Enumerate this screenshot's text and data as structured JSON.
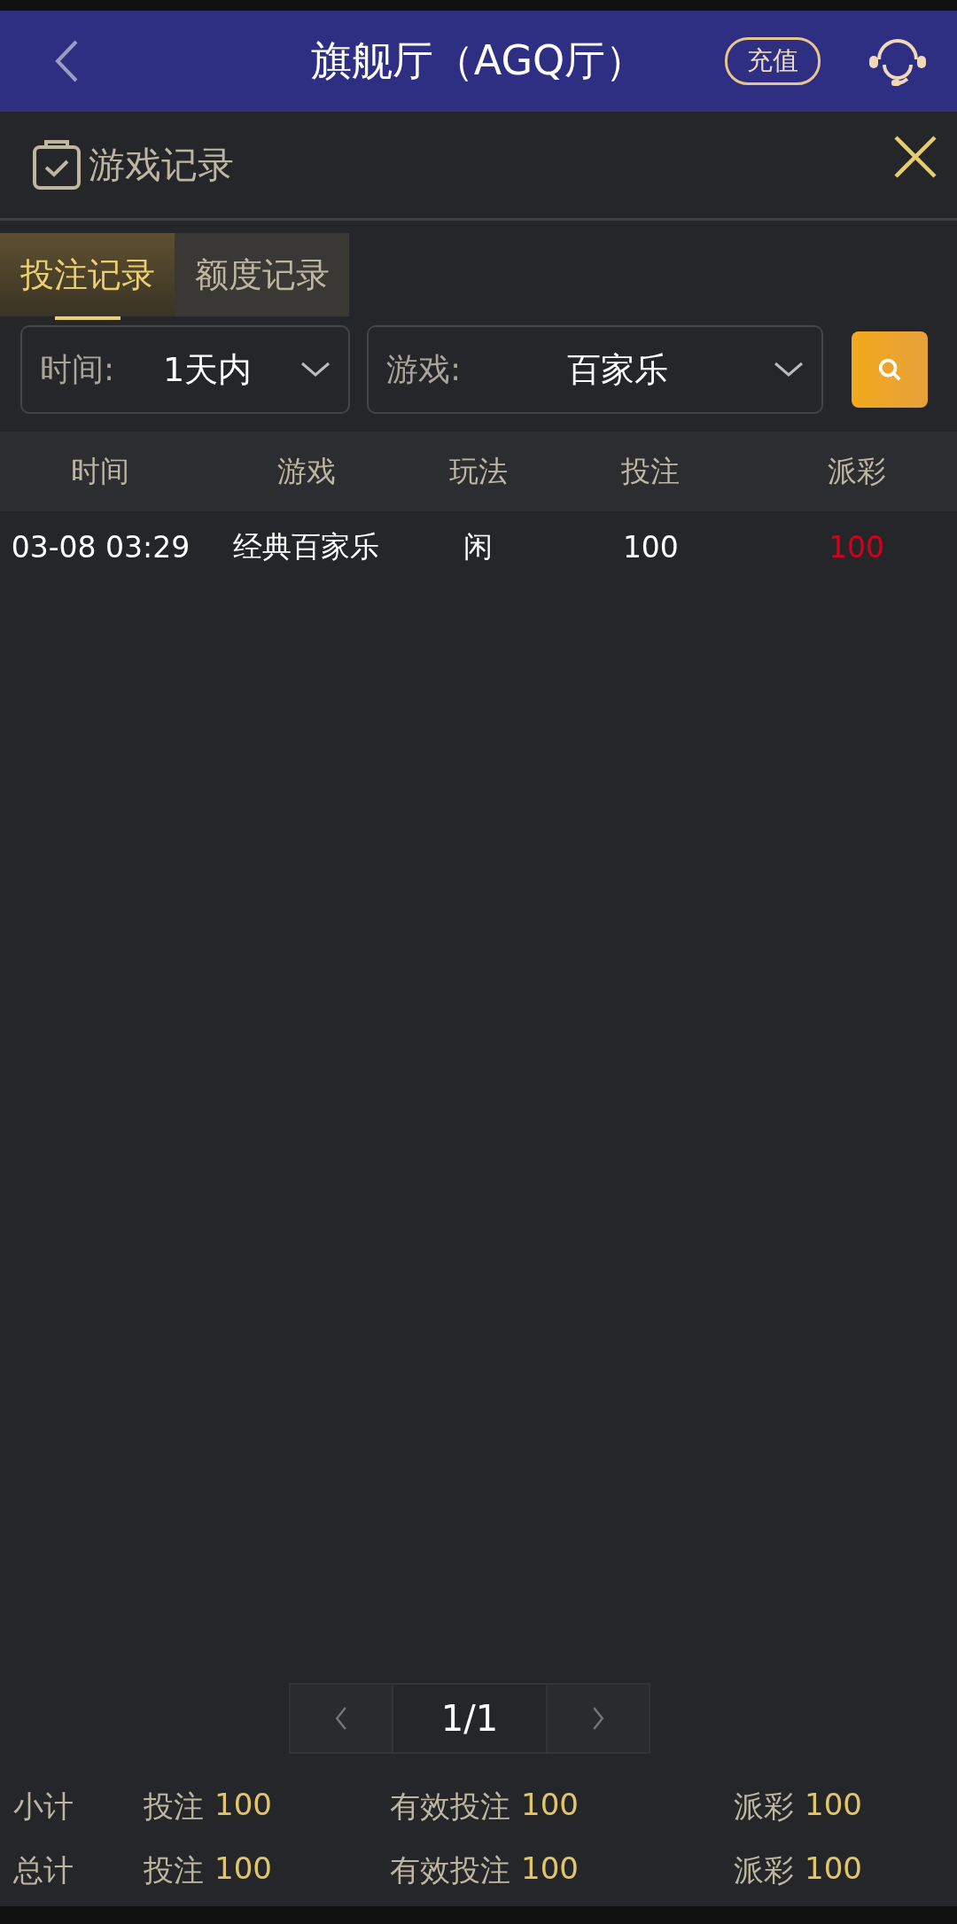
{
  "header": {
    "title": "旗舰厅（AGQ厅）",
    "recharge_button": "充值"
  },
  "panel": {
    "title": "游戏记录"
  },
  "tabs": [
    {
      "label": "投注记录",
      "selected": true
    },
    {
      "label": "额度记录",
      "selected": false
    }
  ],
  "filters": [
    {
      "label": "时间:",
      "value": "1天内"
    },
    {
      "label": "游戏:",
      "value": "百家乐"
    }
  ],
  "table": {
    "columns": [
      "时间",
      "游戏",
      "玩法",
      "投注",
      "派彩"
    ],
    "rows": [
      {
        "cells": [
          {
            "text": "03-08 03:29",
            "color": "#ffffff"
          },
          {
            "text": "经典百家乐",
            "color": "#ffffff"
          },
          {
            "text": "闲",
            "color": "#ffffff"
          },
          {
            "text": "100",
            "color": "#ffffff"
          },
          {
            "text": "100",
            "color": "#d0021b"
          }
        ]
      }
    ]
  },
  "pagination": {
    "page": "1/1"
  },
  "summary": [
    {
      "label": "小计",
      "items": [
        {
          "label": "投注",
          "value": "100"
        },
        {
          "label": "有效投注",
          "value": "100"
        },
        {
          "label": "派彩",
          "value": "100"
        }
      ]
    },
    {
      "label": "总计",
      "items": [
        {
          "label": "投注",
          "value": "100"
        },
        {
          "label": "有效投注",
          "value": "100"
        },
        {
          "label": "派彩",
          "value": "100"
        }
      ]
    }
  ]
}
